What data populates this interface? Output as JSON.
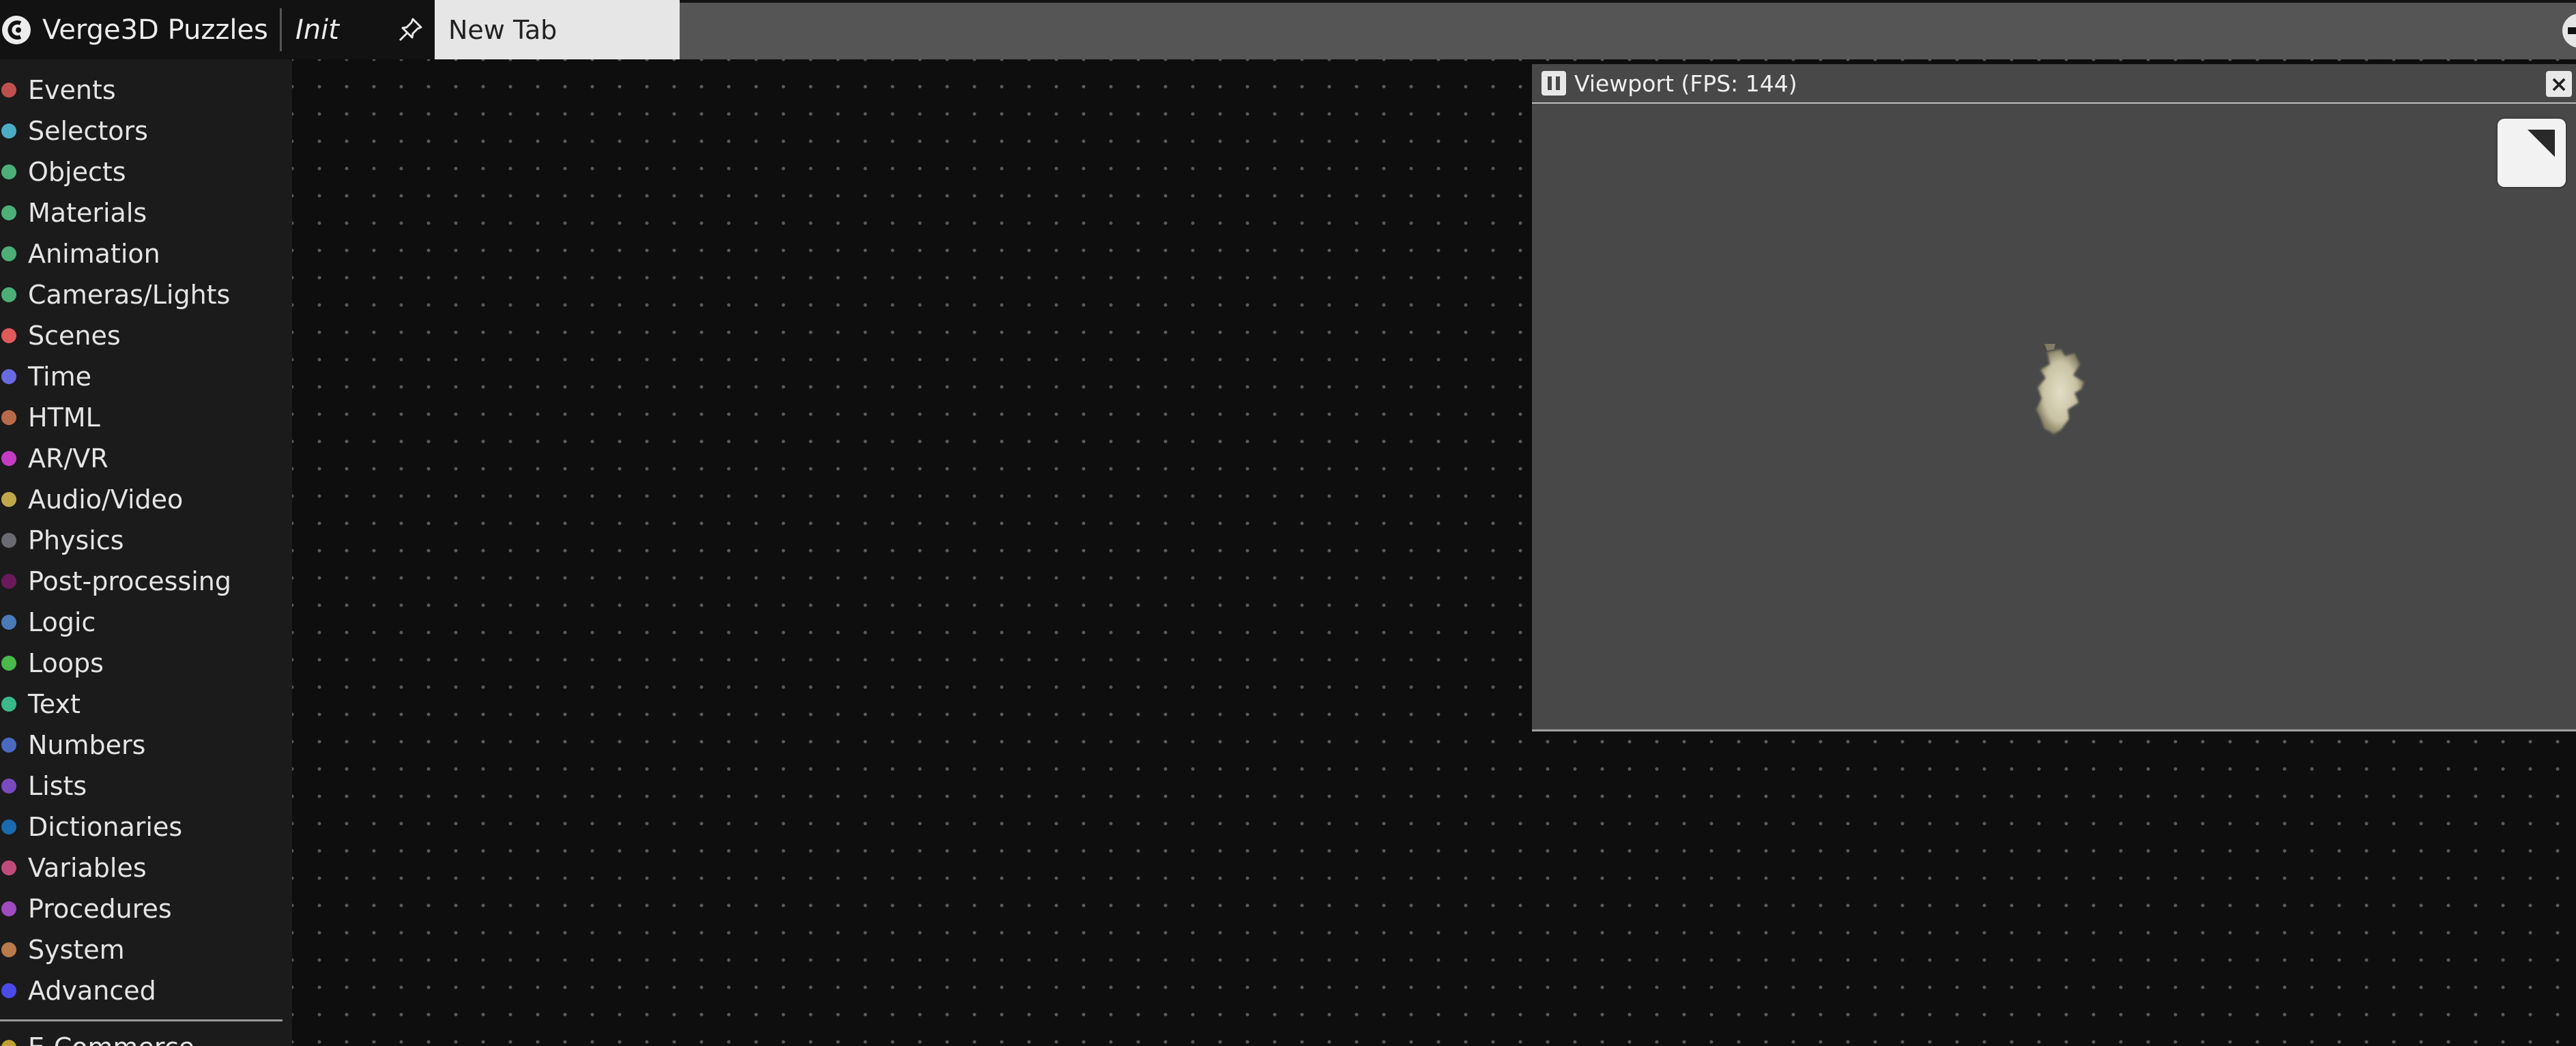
{
  "app": {
    "title": "Verge3D Puzzles"
  },
  "tabs": [
    {
      "label": "Init",
      "italic": true
    },
    {
      "label": "New Tab",
      "active": true
    }
  ],
  "sidebar": {
    "categories": [
      {
        "label": "Events",
        "color": "#c0504d"
      },
      {
        "label": "Selectors",
        "color": "#4bacc6"
      },
      {
        "label": "Objects",
        "color": "#4caf77"
      },
      {
        "label": "Materials",
        "color": "#4caf77"
      },
      {
        "label": "Animation",
        "color": "#4caf77"
      },
      {
        "label": "Cameras/Lights",
        "color": "#4caf77"
      },
      {
        "label": "Scenes",
        "color": "#e05a5a"
      },
      {
        "label": "Time",
        "color": "#6a6ae0"
      },
      {
        "label": "HTML",
        "color": "#b86a4a"
      },
      {
        "label": "AR/VR",
        "color": "#c43cc4"
      },
      {
        "label": "Audio/Video",
        "color": "#c0a84a"
      },
      {
        "label": "Physics",
        "color": "#6a6a72"
      },
      {
        "label": "Post-processing",
        "color": "#6a1a5a"
      },
      {
        "label": "Logic",
        "color": "#4a7ab8"
      },
      {
        "label": "Loops",
        "color": "#4ab84a"
      },
      {
        "label": "Text",
        "color": "#3ab88a"
      },
      {
        "label": "Numbers",
        "color": "#4a6ac0"
      },
      {
        "label": "Lists",
        "color": "#7a4ac0"
      },
      {
        "label": "Dictionaries",
        "color": "#1a6ab0"
      },
      {
        "label": "Variables",
        "color": "#c04a7a"
      },
      {
        "label": "Procedures",
        "color": "#a04ac0"
      },
      {
        "label": "System",
        "color": "#b87a4a"
      },
      {
        "label": "Advanced",
        "color": "#4a4ae8"
      }
    ],
    "extra": {
      "label": "E-Commerce",
      "color": "#c0a030"
    }
  },
  "viewport": {
    "title": "Viewport (FPS: 144)",
    "close_symbol": "×"
  }
}
